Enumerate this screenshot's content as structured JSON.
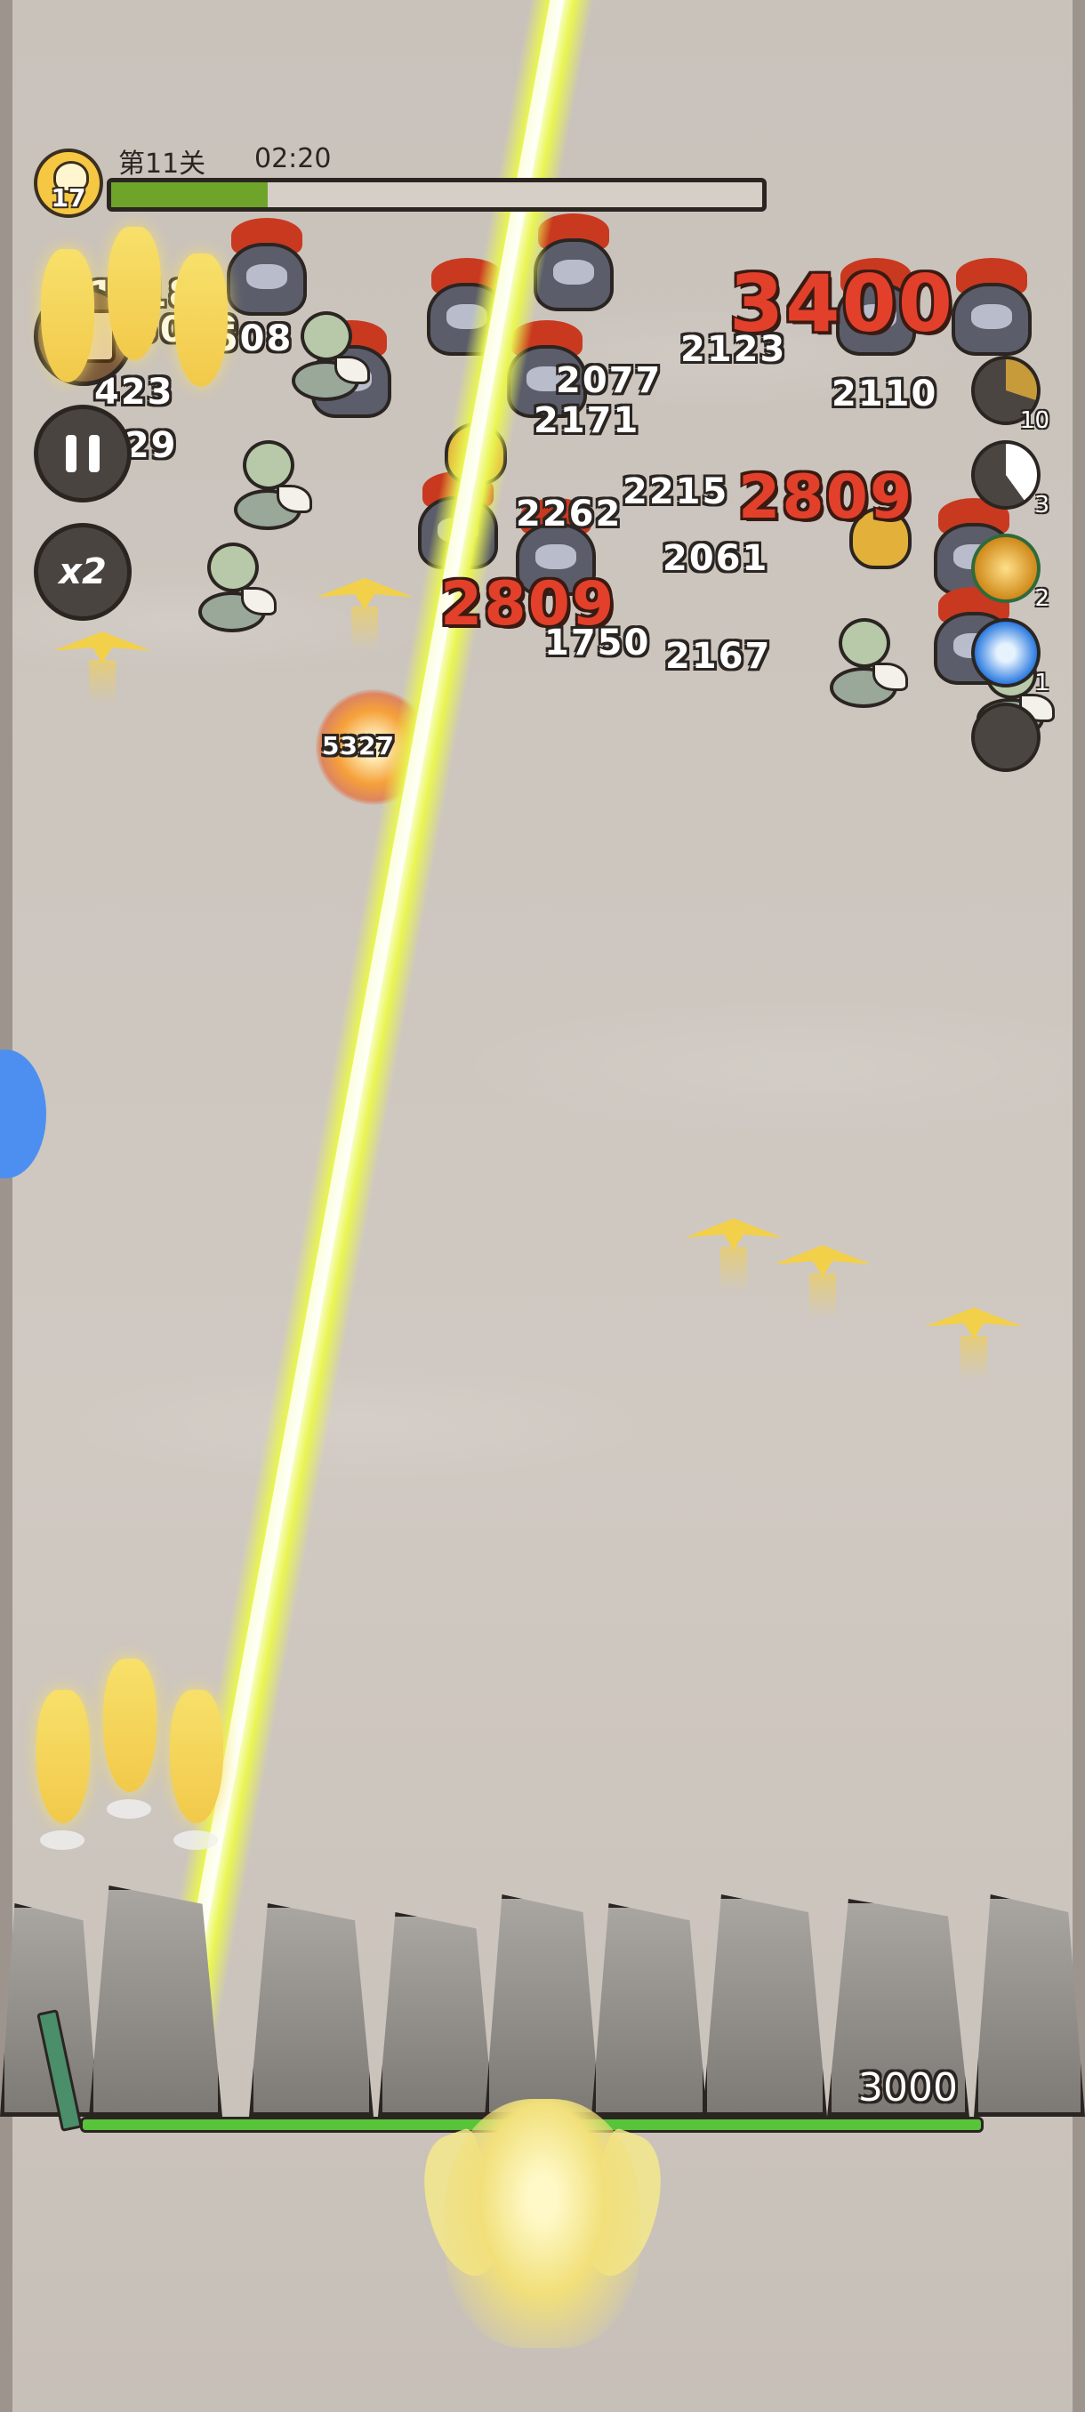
{
  "hud": {
    "level": "17",
    "stage": "第11关",
    "timer": "02:20",
    "progress_fraction": 0.24
  },
  "controls": {
    "speed_label": "x2"
  },
  "skills": [
    {
      "icon": "clock-cooldown-icon",
      "count": "10"
    },
    {
      "icon": "clock-cooldown-icon",
      "count": "3"
    },
    {
      "icon": "fire-dash-icon",
      "count": "2"
    },
    {
      "icon": "ghost-orb-icon",
      "count": "1"
    },
    {
      "icon": "empty-slot-icon",
      "count": ""
    }
  ],
  "damage_numbers": [
    "3400",
    "2809",
    "2809",
    "2077",
    "2171",
    "2262",
    "2215",
    "2061",
    "1750",
    "2167",
    "2110",
    "2123",
    "5327",
    "423",
    "129",
    "1718",
    "5070",
    "1508"
  ],
  "wall": {
    "hp": "3000",
    "hp_fraction": 1.0
  },
  "colors": {
    "progress": "#6fa42b",
    "beam": "#e9f552",
    "crit": "#e2402a",
    "hp": "#58c43a"
  }
}
